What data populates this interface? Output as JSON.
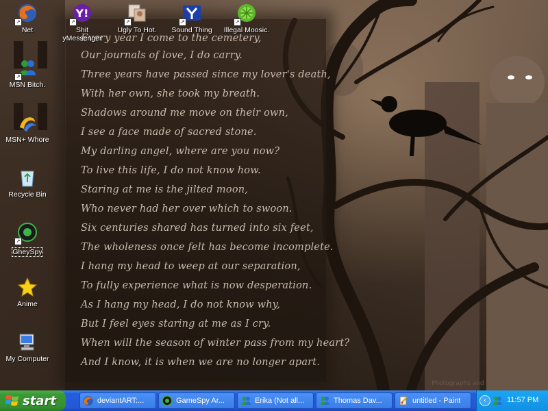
{
  "desktop": {
    "icons": [
      {
        "label": "Net",
        "icon": "firefox-icon"
      },
      {
        "label": "Shit yMessenger",
        "icon": "yahoo-messenger-icon"
      },
      {
        "label": "Ugly To Hot.",
        "icon": "photo-icon"
      },
      {
        "label": "Sound Thing",
        "icon": "sound-app-icon"
      },
      {
        "label": "Illegal Moosic.",
        "icon": "limewire-icon"
      },
      {
        "label": "MSN Bitch.",
        "icon": "msn-icon"
      },
      {
        "label": "MSN+ Whore",
        "icon": "msn-plus-icon"
      },
      {
        "label": "Recycle Bin",
        "icon": "recycle-bin-icon"
      },
      {
        "label": "GheySpy",
        "icon": "gamespy-icon"
      },
      {
        "label": "Anime",
        "icon": "star-icon"
      },
      {
        "label": "My Computer",
        "icon": "my-computer-icon"
      }
    ]
  },
  "wallpaper": {
    "poem": [
      "Every year I come to the cemetery,",
      "Our journals of love, I do carry.",
      "Three years have passed since my lover's death,",
      "With her own, she took my breath.",
      "Shadows around me move on their own,",
      "I see a face made of sacred stone.",
      "My darling angel, where are you now?",
      "To live this life, I do not know how.",
      "Staring at me is the jilted moon,",
      "Who never had her over which to swoon.",
      "Six centuries shared has turned into six feet,",
      "The wholeness once felt has become incomplete.",
      "I hang my head to weep at our separation,",
      "To fully experience what is now desperation.",
      "As I hang my head, I do not know why,",
      "But I feel eyes staring at me as I cry.",
      "When will the season of winter pass from my heart?",
      "And I know, it is when we are no longer apart."
    ],
    "credit": "Photographs and Text: Anne Varnes"
  },
  "taskbar": {
    "start_label": "start",
    "tasks": [
      {
        "label": "deviantART:...",
        "icon": "firefox-icon"
      },
      {
        "label": "GameSpy Ar...",
        "icon": "gamespy-icon"
      },
      {
        "label": "Erika (Not all...",
        "icon": "msn-chat-icon"
      },
      {
        "label": "Thomas Dav...",
        "icon": "msn-chat-icon"
      },
      {
        "label": "untitled - Paint",
        "icon": "paint-icon"
      }
    ],
    "clock": "11:57 PM"
  },
  "colors": {
    "taskbar": "#245edc",
    "start": "#3b9a35",
    "tray": "#1290e3",
    "poem_text": "#c9bcae"
  }
}
